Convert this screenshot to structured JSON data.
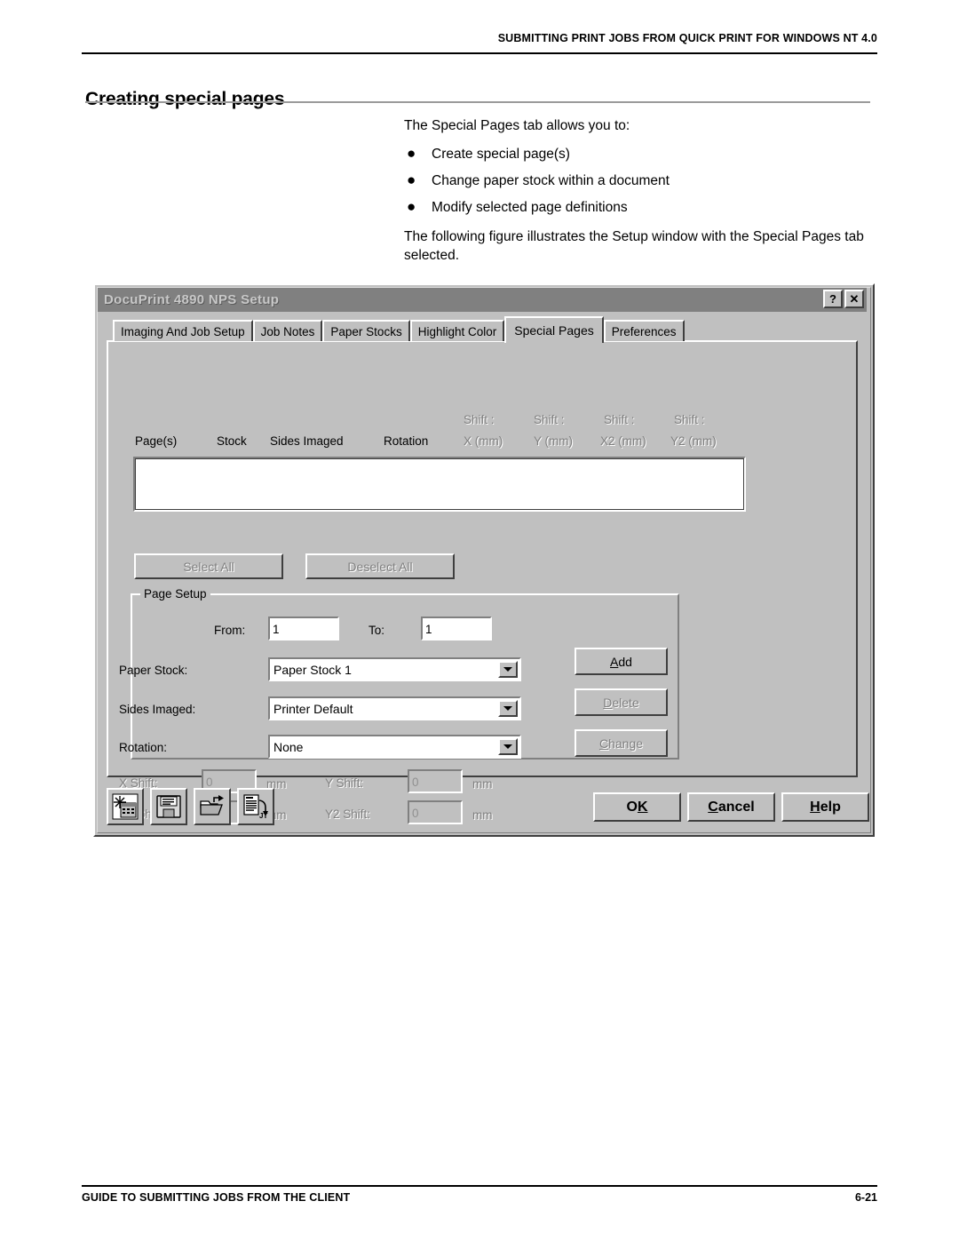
{
  "page": {
    "running_head": "SUBMITTING PRINT JOBS FROM QUICK PRINT FOR WINDOWS NT 4.0",
    "title": "Creating special pages",
    "footer_left": "GUIDE TO SUBMITTING JOBS FROM THE CLIENT",
    "footer_page_number": "6-21"
  },
  "body": {
    "intro": "The Special Pages tab allows you to:",
    "bullets": [
      "Create special page(s)",
      "Change paper stock within a document",
      "Modify selected page definitions"
    ],
    "outro": "The following figure illustrates the Setup window with the Special Pages tab selected."
  },
  "dialog": {
    "title": "DocuPrint 4890 NPS Setup",
    "titlebar_buttons": {
      "help": "?",
      "close": "✕"
    },
    "tabs": [
      {
        "label": "Imaging And Job Setup",
        "active": false
      },
      {
        "label": "Job Notes",
        "active": false
      },
      {
        "label": "Paper Stocks",
        "active": false
      },
      {
        "label": "Highlight Color",
        "active": false
      },
      {
        "label": "Special Pages",
        "active": true
      },
      {
        "label": "Preferences",
        "active": false
      }
    ],
    "grid": {
      "columns": [
        {
          "top": "",
          "label": "Page(s)",
          "disabled": false
        },
        {
          "top": "",
          "label": "Stock",
          "disabled": false
        },
        {
          "top": "",
          "label": "Sides Imaged",
          "disabled": false
        },
        {
          "top": "",
          "label": "Rotation",
          "disabled": false
        },
        {
          "top": "Shift :",
          "label": "X (mm)",
          "disabled": true
        },
        {
          "top": "Shift :",
          "label": "Y (mm)",
          "disabled": true
        },
        {
          "top": "Shift :",
          "label": "X2 (mm)",
          "disabled": true
        },
        {
          "top": "Shift :",
          "label": "Y2 (mm)",
          "disabled": true
        }
      ],
      "rows": []
    },
    "select_all_label": "Select All",
    "deselect_all_label": "Deselect All",
    "page_setup": {
      "group_title": "Page Setup",
      "from_label": "From:",
      "from_value": "1",
      "to_label": "To:",
      "to_value": "1",
      "paper_stock_label": "Paper Stock:",
      "paper_stock_value": "Paper Stock 1",
      "sides_imaged_label": "Sides Imaged:",
      "sides_imaged_value": "Printer Default",
      "rotation_label": "Rotation:",
      "rotation_value": "None",
      "x_shift_label": "X Shift:",
      "x_shift_value": "0",
      "y_shift_label": "Y Shift:",
      "y_shift_value": "0",
      "x2_shift_label": "X2 Shift:",
      "x2_shift_value": "0",
      "y2_shift_label": "Y2 Shift:",
      "y2_shift_value": "0",
      "unit_1": "mm",
      "unit_2": "mm",
      "unit_3": "mm",
      "unit_4": "mm"
    },
    "action_buttons": {
      "add": "Add",
      "delete": "Delete",
      "change": "Change"
    },
    "toolbar_icons": [
      "restore-defaults-icon",
      "save-settings-icon",
      "open-settings-icon",
      "job-ticket-icon"
    ],
    "toolbar_job_ticket_label": "JT",
    "footer_buttons": {
      "ok": "OK",
      "cancel": "Cancel",
      "help": "Help"
    }
  }
}
